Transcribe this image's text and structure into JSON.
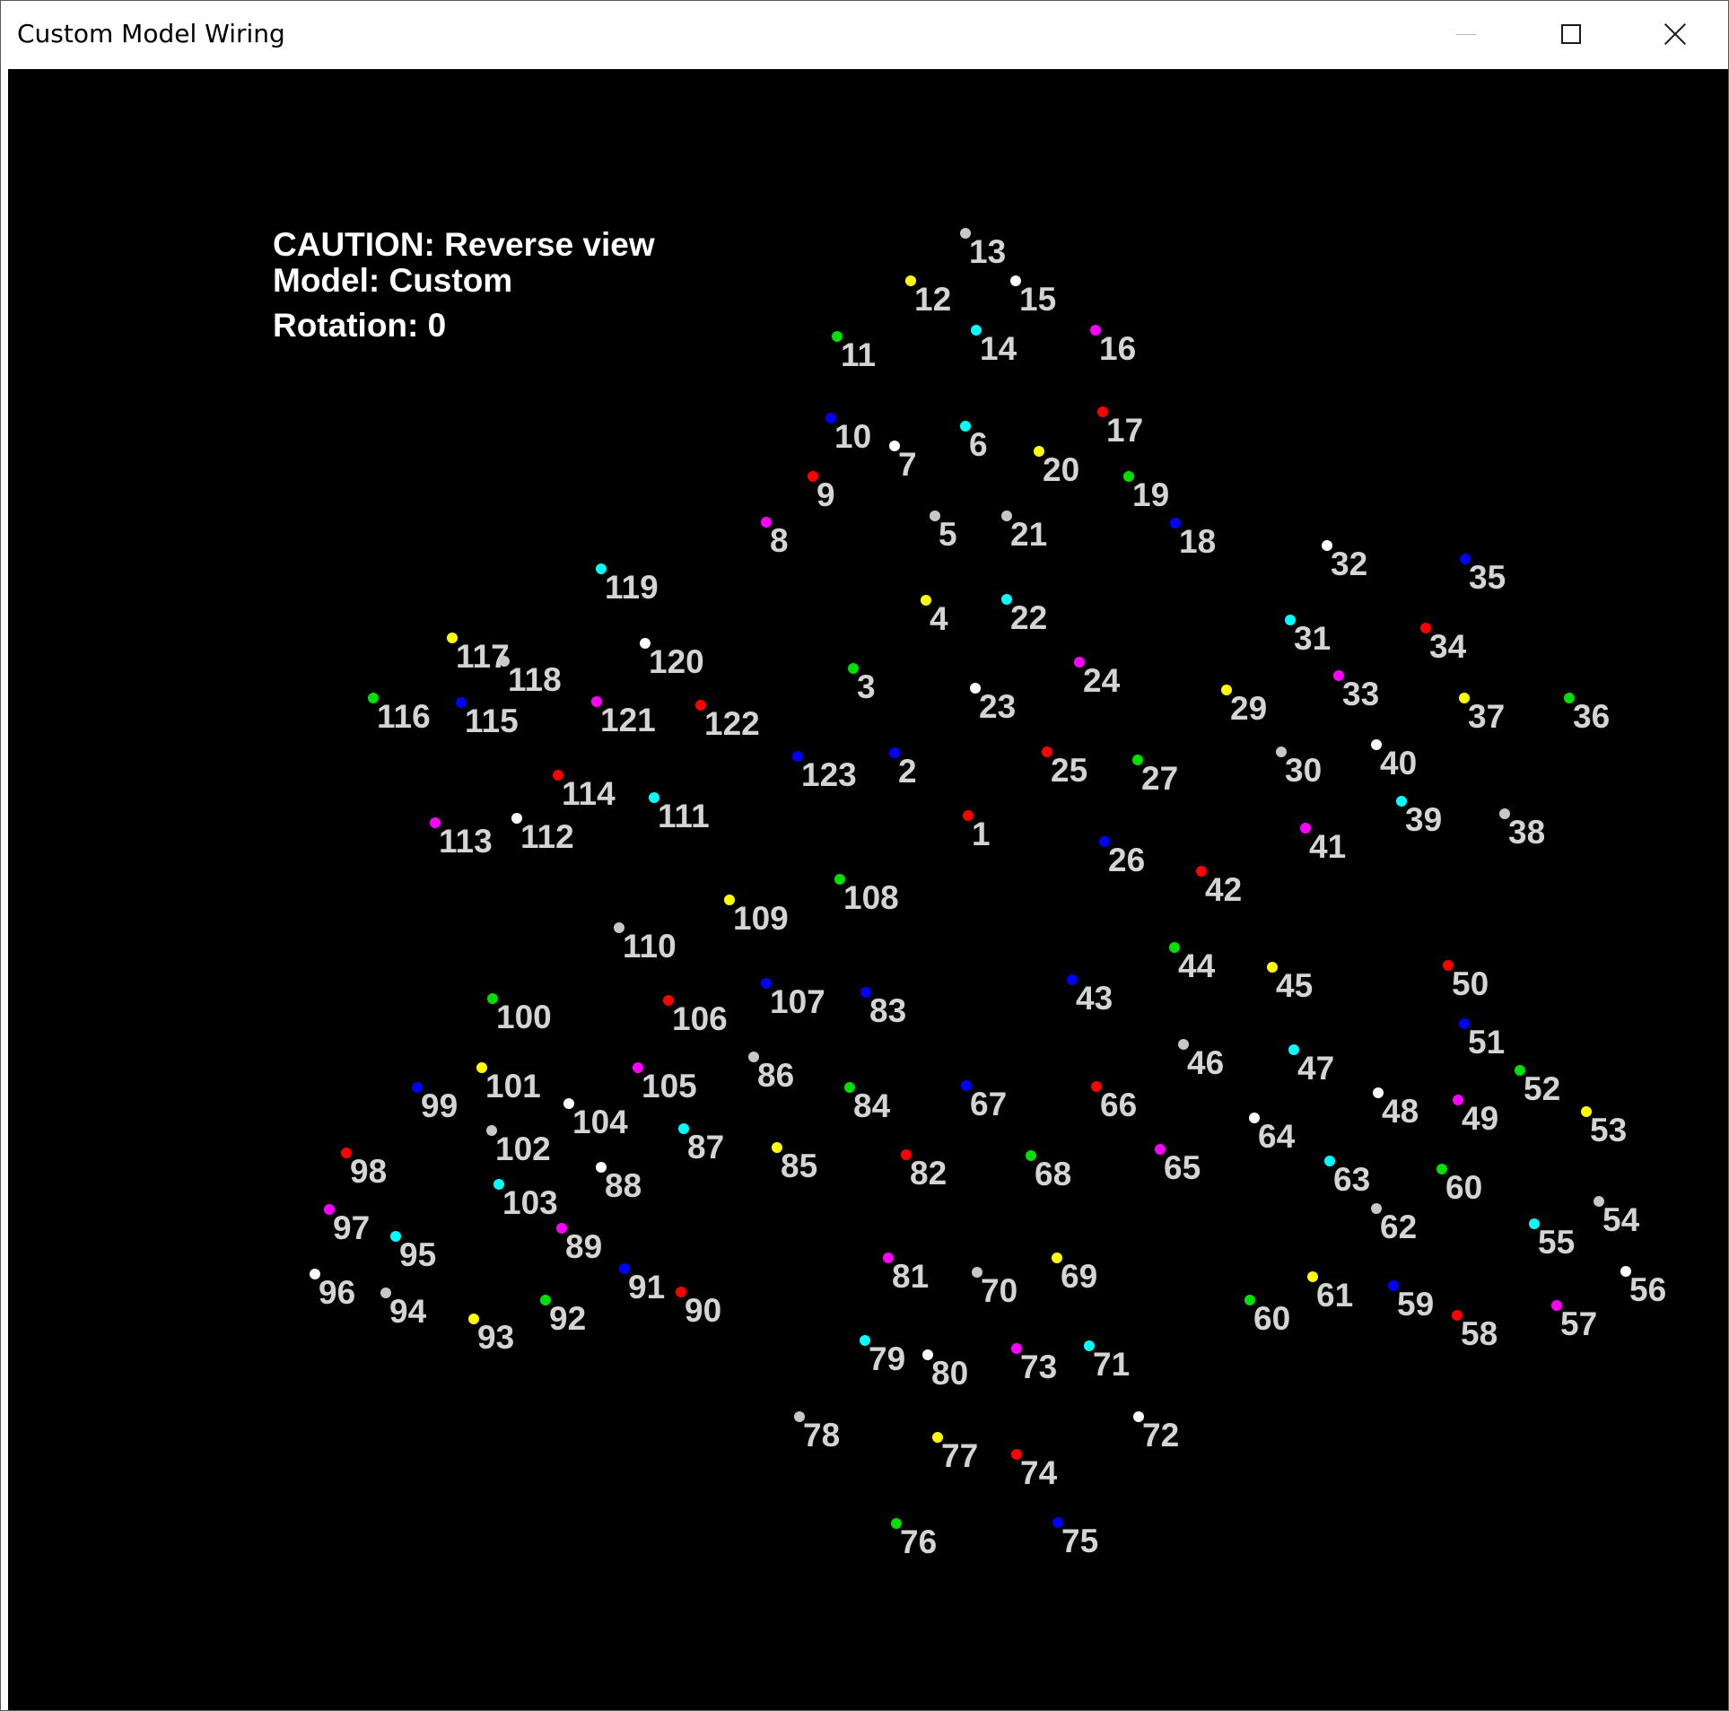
{
  "window": {
    "title": "Custom Model Wiring"
  },
  "overlay": {
    "caution": "CAUTION: Reverse view",
    "model": "Model: Custom",
    "rotation": "Rotation: 0"
  },
  "colors": {
    "red": "#ff0000",
    "blue": "#0000ff",
    "green": "#00e000",
    "yellow": "#ffff00",
    "cyan": "#00ffff",
    "magenta": "#ff00ff",
    "white": "#ffffff",
    "gray": "#c8c8c8",
    "label": "#d4d4d4"
  },
  "nodes": [
    {
      "label": "1",
      "color": "red"
    },
    {
      "label": "2",
      "color": "blue"
    },
    {
      "label": "3",
      "color": "green"
    },
    {
      "label": "4",
      "color": "yellow"
    },
    {
      "label": "5",
      "color": "gray"
    },
    {
      "label": "6",
      "color": "cyan"
    },
    {
      "label": "7",
      "color": "white"
    },
    {
      "label": "8",
      "color": "magenta"
    },
    {
      "label": "9",
      "color": "red"
    },
    {
      "label": "10",
      "color": "blue"
    },
    {
      "label": "11",
      "color": "green"
    },
    {
      "label": "12",
      "color": "yellow"
    },
    {
      "label": "13",
      "color": "gray"
    },
    {
      "label": "14",
      "color": "cyan"
    },
    {
      "label": "15",
      "color": "white"
    },
    {
      "label": "16",
      "color": "magenta"
    },
    {
      "label": "17",
      "color": "red"
    },
    {
      "label": "18",
      "color": "blue"
    },
    {
      "label": "19",
      "color": "green"
    },
    {
      "label": "20",
      "color": "yellow"
    },
    {
      "label": "21",
      "color": "gray"
    },
    {
      "label": "22",
      "color": "cyan"
    },
    {
      "label": "23",
      "color": "white"
    },
    {
      "label": "24",
      "color": "magenta"
    },
    {
      "label": "25",
      "color": "red"
    },
    {
      "label": "26",
      "color": "blue"
    },
    {
      "label": "27",
      "color": "green"
    },
    {
      "label": "29",
      "color": "yellow"
    },
    {
      "label": "30",
      "color": "gray"
    },
    {
      "label": "31",
      "color": "cyan"
    },
    {
      "label": "32",
      "color": "white"
    },
    {
      "label": "33",
      "color": "magenta"
    },
    {
      "label": "34",
      "color": "red"
    },
    {
      "label": "35",
      "color": "blue"
    },
    {
      "label": "36",
      "color": "green"
    },
    {
      "label": "37",
      "color": "yellow"
    },
    {
      "label": "38",
      "color": "gray"
    },
    {
      "label": "39",
      "color": "cyan"
    },
    {
      "label": "40",
      "color": "white"
    },
    {
      "label": "41",
      "color": "magenta"
    },
    {
      "label": "42",
      "color": "red"
    },
    {
      "label": "43",
      "color": "blue"
    },
    {
      "label": "44",
      "color": "green"
    },
    {
      "label": "45",
      "color": "yellow"
    },
    {
      "label": "46",
      "color": "gray"
    },
    {
      "label": "47",
      "color": "cyan"
    },
    {
      "label": "48",
      "color": "white"
    },
    {
      "label": "49",
      "color": "magenta"
    },
    {
      "label": "50",
      "color": "red"
    },
    {
      "label": "51",
      "color": "blue"
    },
    {
      "label": "52",
      "color": "green"
    },
    {
      "label": "53",
      "color": "yellow"
    },
    {
      "label": "54",
      "color": "gray"
    },
    {
      "label": "55",
      "color": "cyan"
    },
    {
      "label": "56",
      "color": "white"
    },
    {
      "label": "57",
      "color": "magenta"
    },
    {
      "label": "58",
      "color": "red"
    },
    {
      "label": "59",
      "color": "blue"
    },
    {
      "label": "60",
      "color": "green"
    },
    {
      "label": "60",
      "color": "green"
    },
    {
      "label": "61",
      "color": "yellow"
    },
    {
      "label": "62",
      "color": "gray"
    },
    {
      "label": "63",
      "color": "cyan"
    },
    {
      "label": "64",
      "color": "white"
    },
    {
      "label": "65",
      "color": "magenta"
    },
    {
      "label": "66",
      "color": "red"
    },
    {
      "label": "67",
      "color": "blue"
    },
    {
      "label": "68",
      "color": "green"
    },
    {
      "label": "69",
      "color": "yellow"
    },
    {
      "label": "70",
      "color": "gray"
    },
    {
      "label": "71",
      "color": "cyan"
    },
    {
      "label": "72",
      "color": "white"
    },
    {
      "label": "73",
      "color": "magenta"
    },
    {
      "label": "74",
      "color": "red"
    },
    {
      "label": "75",
      "color": "blue"
    },
    {
      "label": "76",
      "color": "green"
    },
    {
      "label": "77",
      "color": "yellow"
    },
    {
      "label": "78",
      "color": "gray"
    },
    {
      "label": "79",
      "color": "cyan"
    },
    {
      "label": "80",
      "color": "white"
    },
    {
      "label": "81",
      "color": "magenta"
    },
    {
      "label": "82",
      "color": "red"
    },
    {
      "label": "83",
      "color": "blue"
    },
    {
      "label": "84",
      "color": "green"
    },
    {
      "label": "85",
      "color": "yellow"
    },
    {
      "label": "86",
      "color": "gray"
    },
    {
      "label": "87",
      "color": "cyan"
    },
    {
      "label": "88",
      "color": "white"
    },
    {
      "label": "89",
      "color": "magenta"
    },
    {
      "label": "90",
      "color": "red"
    },
    {
      "label": "91",
      "color": "blue"
    },
    {
      "label": "92",
      "color": "green"
    },
    {
      "label": "93",
      "color": "yellow"
    },
    {
      "label": "94",
      "color": "gray"
    },
    {
      "label": "95",
      "color": "cyan"
    },
    {
      "label": "96",
      "color": "white"
    },
    {
      "label": "97",
      "color": "magenta"
    },
    {
      "label": "98",
      "color": "red"
    },
    {
      "label": "99",
      "color": "blue"
    },
    {
      "label": "100",
      "color": "green"
    },
    {
      "label": "101",
      "color": "yellow"
    },
    {
      "label": "102",
      "color": "gray"
    },
    {
      "label": "103",
      "color": "cyan"
    },
    {
      "label": "104",
      "color": "white"
    },
    {
      "label": "105",
      "color": "magenta"
    },
    {
      "label": "106",
      "color": "red"
    },
    {
      "label": "107",
      "color": "blue"
    },
    {
      "label": "108",
      "color": "green"
    },
    {
      "label": "109",
      "color": "yellow"
    },
    {
      "label": "110",
      "color": "gray"
    },
    {
      "label": "111",
      "color": "cyan"
    },
    {
      "label": "112",
      "color": "white"
    },
    {
      "label": "113",
      "color": "magenta"
    },
    {
      "label": "114",
      "color": "red"
    },
    {
      "label": "115",
      "color": "blue"
    },
    {
      "label": "116",
      "color": "green"
    },
    {
      "label": "117",
      "color": "yellow"
    },
    {
      "label": "118",
      "color": "gray"
    },
    {
      "label": "119",
      "color": "cyan"
    },
    {
      "label": "120",
      "color": "white"
    },
    {
      "label": "121",
      "color": "magenta"
    },
    {
      "label": "122",
      "color": "red"
    },
    {
      "label": "123",
      "color": "blue"
    }
  ]
}
